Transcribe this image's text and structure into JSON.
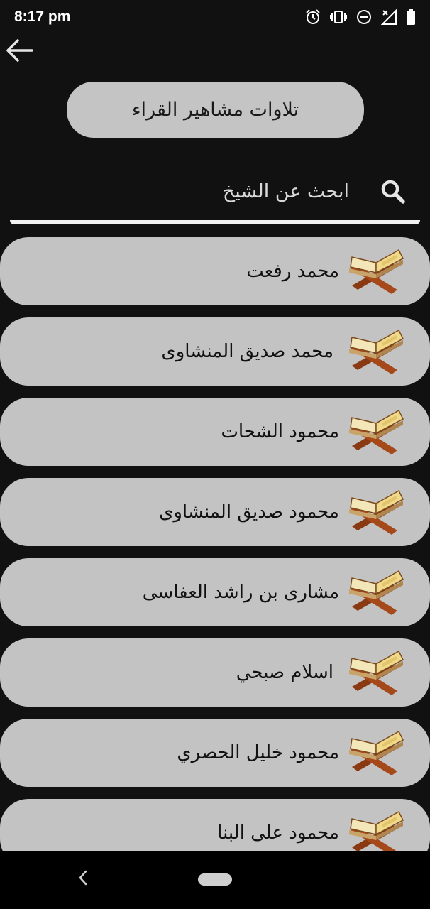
{
  "status_bar": {
    "time": "8:17 pm",
    "icons": [
      "alarm-icon",
      "vibrate-icon",
      "do-not-disturb-icon",
      "signal-off-icon",
      "battery-icon"
    ]
  },
  "header": {
    "back_icon": "arrow-left-icon",
    "title": "تلاوات مشاهير القراء"
  },
  "search": {
    "placeholder": "ابحث عن الشيخ",
    "icon": "search-icon"
  },
  "reciters": [
    {
      "name": "محمد رفعت"
    },
    {
      "name": "محمد صديق المنشاوى"
    },
    {
      "name": "محمود الشحات"
    },
    {
      "name": "محمود صديق المنشاوى"
    },
    {
      "name": "مشارى بن راشد العفاسى"
    },
    {
      "name": "اسلام صبحي"
    },
    {
      "name": "محمود خليل الحصري"
    },
    {
      "name": "محمود على البنا"
    }
  ],
  "colors": {
    "background": "#111111",
    "pill": "#c4c4c4",
    "text_dark": "#111111"
  },
  "nav_bar": {
    "icons": [
      "back-chevron-icon",
      "home-pill-icon"
    ]
  }
}
